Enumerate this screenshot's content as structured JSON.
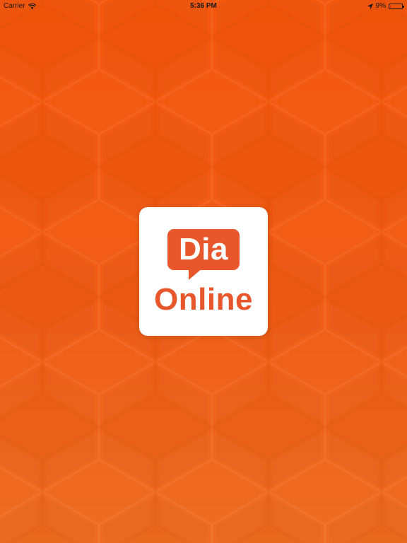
{
  "status_bar": {
    "carrier": "Carrier",
    "time": "5:36 PM",
    "battery_percent_label": "9%",
    "battery_level": 0.09,
    "icons": [
      "wifi-icon",
      "location-arrow-icon",
      "battery-icon"
    ]
  },
  "logo": {
    "line1": "Dia",
    "line2": "Online"
  },
  "colors": {
    "background": "#f4550a",
    "accent": "#e8562c",
    "card": "#ffffff"
  }
}
